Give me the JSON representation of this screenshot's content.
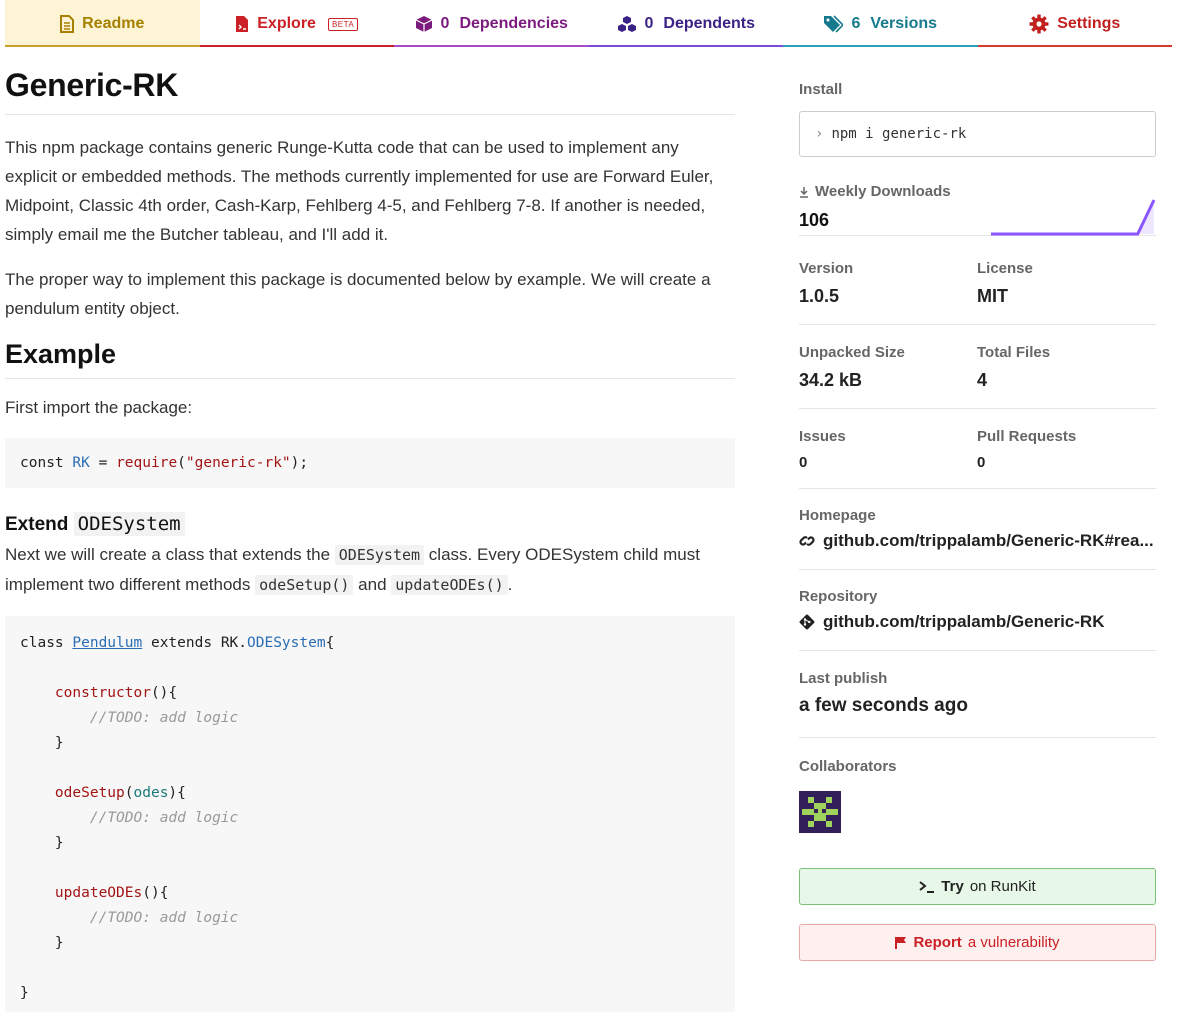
{
  "tabs": [
    {
      "label": "Readme",
      "count": "",
      "icon": "readme-file-icon"
    },
    {
      "label": "Explore",
      "count": "",
      "badge": "BETA",
      "icon": "explore-file-icon"
    },
    {
      "label": "Dependencies",
      "count": "0",
      "icon": "box-icon"
    },
    {
      "label": "Dependents",
      "count": "0",
      "icon": "boxes-icon"
    },
    {
      "label": "Versions",
      "count": "6",
      "icon": "tags-icon"
    },
    {
      "label": "Settings",
      "count": "",
      "icon": "gear-icon"
    }
  ],
  "readme": {
    "title": "Generic-RK",
    "intro": "This npm package contains generic Runge-Kutta code that can be used to implement any explicit or embedded methods. The methods currently implemented for use are Forward Euler, Midpoint, Classic 4th order, Cash-Karp, Fehlberg 4-5, and Fehlberg 7-8. If another is needed, simply email me the Butcher tableau, and I'll add it.",
    "proper_way": "The proper way to implement this package is documented below by example. We will create a pendulum entity object.",
    "example_heading": "Example",
    "first_import": "First import the package:",
    "code1": {
      "kw": "const",
      "var": "RK",
      "eq": "=",
      "fn": "require",
      "str": "\"generic-rk\"",
      "tail": ");"
    },
    "extend_heading": "Extend",
    "extend_code": "ODESystem",
    "next_pre": "Next we will create a class that extends the",
    "next_code1": "ODESystem",
    "next_mid": "class. Every ODESystem child must implement two different methods",
    "next_code2": "odeSetup()",
    "next_and": "and",
    "next_code3": "updateODEs()",
    "next_end": ".",
    "code2": {
      "class_kw": "class",
      "class_name": "Pendulum",
      "extends_kw": "extends",
      "base_obj": "RK.",
      "base_cls": "ODESystem",
      "open_brace": "{",
      "ctor": "constructor",
      "setup": "odeSetup",
      "setup_param": "odes",
      "update": "updateODEs",
      "todo_tag": "TODO",
      "todo_text": ": add logic",
      "close_brace": "}"
    }
  },
  "sidebar": {
    "install_label": "Install",
    "install_cmd": "npm i generic-rk",
    "weekly_label": "Weekly Downloads",
    "weekly_value": "106",
    "weekly_series": [
      0,
      0,
      0,
      0,
      0,
      0,
      0,
      0,
      0,
      0,
      1
    ],
    "version_label": "Version",
    "version_value": "1.0.5",
    "license_label": "License",
    "license_value": "MIT",
    "size_label": "Unpacked Size",
    "size_value": "34.2 kB",
    "files_label": "Total Files",
    "files_value": "4",
    "issues_label": "Issues",
    "issues_value": "0",
    "pr_label": "Pull Requests",
    "pr_value": "0",
    "homepage_label": "Homepage",
    "homepage_value": "github.com/trippalamb/Generic-RK#rea...",
    "repo_label": "Repository",
    "repo_value": "github.com/trippalamb/Generic-RK",
    "publish_label": "Last publish",
    "publish_value": "a few seconds ago",
    "collab_label": "Collaborators",
    "runkit_bold": "Try",
    "runkit_rest": "on RunKit",
    "report_bold": "Report",
    "report_rest": "a vulnerability"
  },
  "colors": {
    "readme_tab": "#c9a127",
    "explore_tab": "#cb2026",
    "deps_tab": "#a64dcc",
    "dependents_tab": "#7b4bd6",
    "versions_tab": "#29a3b8",
    "settings_tab": "#d63a2e",
    "sparkline": "#8956ff"
  }
}
